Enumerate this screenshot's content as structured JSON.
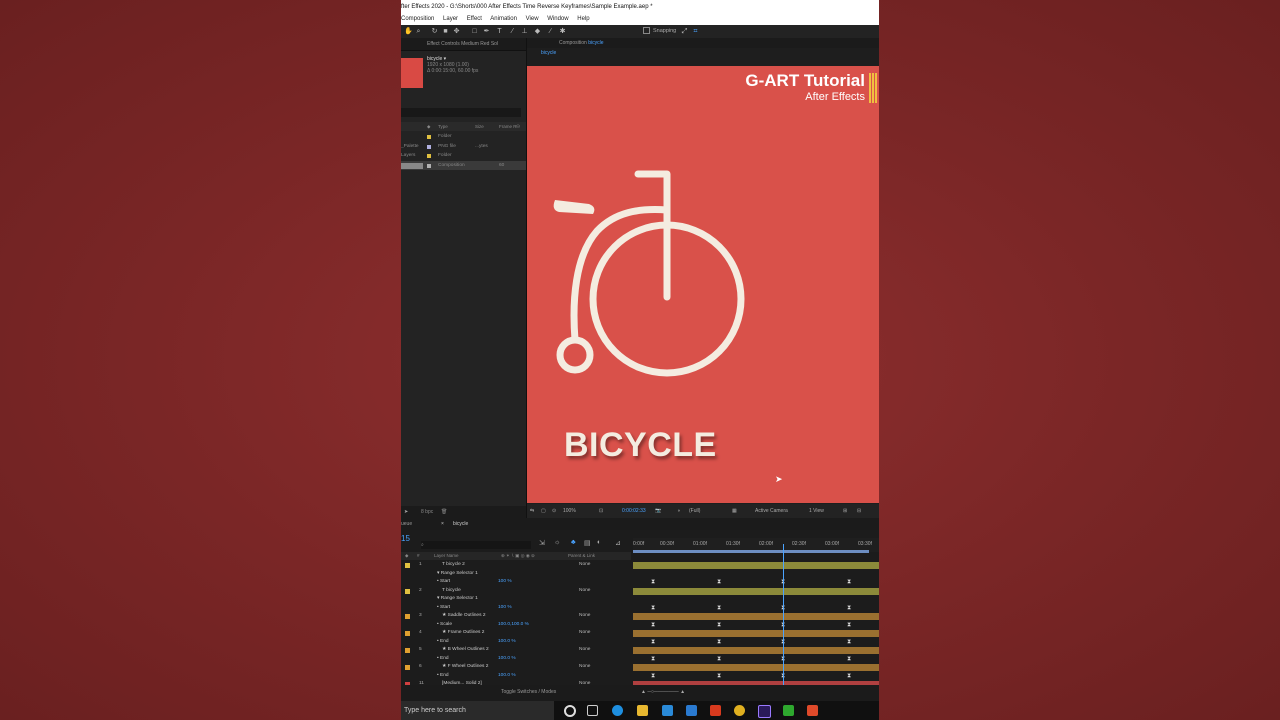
{
  "window": {
    "title": "fter Effects 2020 - G:\\Shorts\\000 After Effects Time Reverse Keyframes\\Sample Example.aep *",
    "menu": [
      "Composition",
      "Layer",
      "Effect",
      "Animation",
      "View",
      "Window",
      "Help"
    ],
    "snapping_label": "Snapping"
  },
  "project_panel": {
    "header": "Effect Controls Medium Red Sol",
    "item_name": "bicycle ▾",
    "item_size": "1920 x 1080 (1.00)",
    "item_duration": "Δ 0:00:15:00, 60.00 fps",
    "columns": [
      "Type",
      "Size",
      "Frame R"
    ],
    "rows": [
      {
        "name": "",
        "type": "Folder",
        "size": "",
        "frame": "",
        "color": "#e0c040"
      },
      {
        "name": "_Palette",
        "type": "PNG file",
        "size": "...ytes",
        "frame": "",
        "color": "#b0b0e0"
      },
      {
        "name": "Layers",
        "type": "Folder",
        "size": "",
        "frame": "",
        "color": "#e0c040"
      },
      {
        "name": "",
        "type": "Composition",
        "size": "",
        "frame": "60",
        "color": "#b0b0b0"
      }
    ],
    "footer_bpc": "8 bpc"
  },
  "viewer": {
    "header_prefix": "Composition",
    "header_comp": "bicycle",
    "tab": "bicycle",
    "brand_title": "G-ART Tutorial",
    "brand_sub": "After Effects",
    "comp_text": "BICYCLE",
    "brand_bar_color": "#f0c040",
    "canvas_color": "#d9514a",
    "zoom": "100%",
    "timecode": "0:00:02:33",
    "resolution": "(Full)",
    "camera": "Active Camera",
    "views": "1 View"
  },
  "timeline": {
    "panel_tab": "bicycle",
    "render_tab": "ueue",
    "timecode": "15",
    "col_layer_name": "Layer Name",
    "col_parent": "Parent & Link",
    "ruler": [
      "0:00f",
      "00:30f",
      "01:00f",
      "01:30f",
      "02:00f",
      "02:30f",
      "03:00f",
      "03:30f"
    ],
    "layers": [
      {
        "num": "1",
        "name": "T  bicycle 2",
        "value": "",
        "parent": "None",
        "label": "#e0c040",
        "bar": "#8c8a3a"
      },
      {
        "num": "",
        "name": "▾ Range Selector 1",
        "value": "",
        "parent": "",
        "label": "",
        "bar": ""
      },
      {
        "num": "",
        "name": "• Start",
        "value": "100 %",
        "parent": "",
        "label": "",
        "bar": "",
        "kf": true
      },
      {
        "num": "2",
        "name": "T  bicycle",
        "value": "",
        "parent": "None",
        "label": "#e0c040",
        "bar": "#8c8a3a"
      },
      {
        "num": "",
        "name": "▾ Range Selector 1",
        "value": "",
        "parent": "",
        "label": "",
        "bar": ""
      },
      {
        "num": "",
        "name": "• Start",
        "value": "100 %",
        "parent": "",
        "label": "",
        "bar": "",
        "kf": true
      },
      {
        "num": "3",
        "name": "★ Saddle Outlines 2",
        "value": "",
        "parent": "None",
        "label": "#e0a030",
        "bar": "#9a7030"
      },
      {
        "num": "",
        "name": "• Scale",
        "value": "100.0,100.0 %",
        "parent": "",
        "label": "",
        "bar": "",
        "kf": true
      },
      {
        "num": "4",
        "name": "★ Frame Outlines 2",
        "value": "",
        "parent": "None",
        "label": "#e0a030",
        "bar": "#9a7030"
      },
      {
        "num": "",
        "name": "• End",
        "value": "100.0 %",
        "parent": "",
        "label": "",
        "bar": "",
        "kf": true
      },
      {
        "num": "5",
        "name": "★ B Wheel Outlines 2",
        "value": "",
        "parent": "None",
        "label": "#e0a030",
        "bar": "#9a7030"
      },
      {
        "num": "",
        "name": "• End",
        "value": "100.0 %",
        "parent": "",
        "label": "",
        "bar": "",
        "kf": true
      },
      {
        "num": "6",
        "name": "★ F Wheel Outlines 2",
        "value": "",
        "parent": "None",
        "label": "#e0a030",
        "bar": "#9a7030"
      },
      {
        "num": "",
        "name": "• End",
        "value": "100.0 %",
        "parent": "",
        "label": "",
        "bar": "",
        "kf": true
      },
      {
        "num": "11",
        "name": "[Medium... Solid 2]",
        "value": "",
        "parent": "None",
        "label": "#d04040",
        "bar": "#b04040"
      }
    ],
    "footer": "Toggle Switches / Modes"
  },
  "taskbar": {
    "search_placeholder": "Type here to search"
  }
}
